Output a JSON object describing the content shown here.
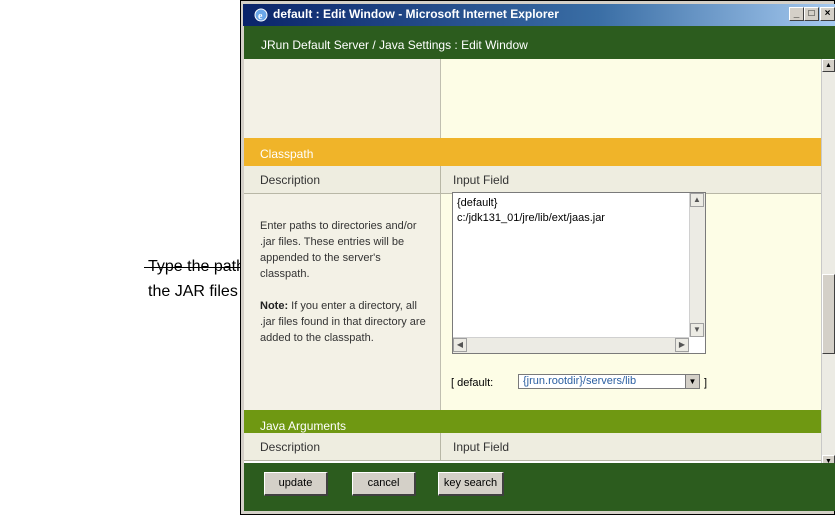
{
  "callout": {
    "line1": "Type the path to",
    "line2": "the JAR files here."
  },
  "window": {
    "title": "default : Edit Window - Microsoft Internet Explorer",
    "controls": [
      "_",
      "□",
      "×"
    ]
  },
  "header": {
    "breadcrumb": "JRun Default Server / Java Settings : Edit Window"
  },
  "classpath": {
    "section_title": "Classpath",
    "col_description": "Description",
    "col_input": "Input Field",
    "desc_paragraph": "Enter paths to directories and/or .jar files. These entries will be appended to the server's classpath.",
    "note_label": "Note:",
    "note_text": " If you enter a directory, all .jar files found in that directory are added to the classpath.",
    "textarea_lines": [
      "{default}",
      "c:/jdk131_01/jre/lib/ext/jaas.jar"
    ],
    "default_label": "[ default:",
    "default_value": "{jrun.rootdir}/servers/lib",
    "default_end": "]"
  },
  "java_args": {
    "section_title": "Java Arguments",
    "col_description": "Description",
    "col_input": "Input Field"
  },
  "footer": {
    "update": "update",
    "cancel": "cancel",
    "key_search": "key search"
  },
  "colors": {
    "classpath_header": "#f0b429",
    "java_header": "#6f9812",
    "dark_green": "#2c5c1e"
  }
}
